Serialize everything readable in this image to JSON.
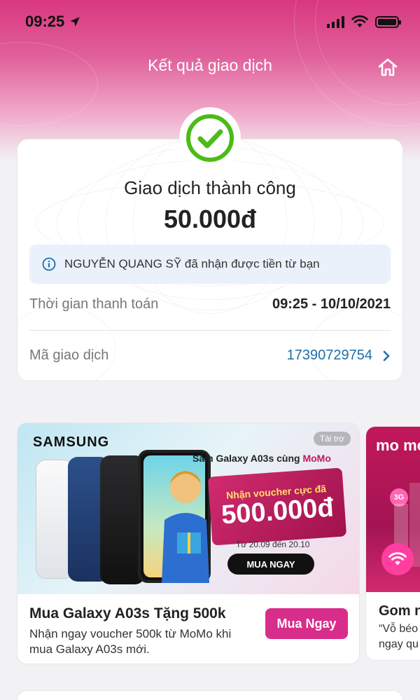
{
  "status_bar": {
    "time": "09:25"
  },
  "header": {
    "title": "Kết quả giao dịch",
    "home_icon": "home-icon"
  },
  "result": {
    "status_text": "Giao dịch thành công",
    "amount": "50.000đ",
    "info_message": "NGUYỄN QUANG SỸ đã nhận được tiền từ bạn",
    "payment_time_label": "Thời gian thanh toán",
    "payment_time_value": "09:25 - 10/10/2021",
    "transaction_id_label": "Mã giao dịch",
    "transaction_id_value": "17390729754"
  },
  "promos": [
    {
      "banner": {
        "brand": "SAMSUNG",
        "sponsor_tag": "Tài trợ",
        "headline_prefix": "Sắm Galaxy A03s cùng",
        "headline_brand": "MoMo",
        "voucher_sub": "Nhận voucher cực đã",
        "voucher_amount": "500.000đ",
        "date_range": "Từ 20.09 đến 20.10",
        "cta": "MUA NGAY"
      },
      "title": "Mua Galaxy A03s Tặng 500k",
      "description": "Nhận ngay voucher 500k từ MoMo khi mua Galaxy A03s mới.",
      "button_label": "Mua Ngay"
    },
    {
      "banner": {
        "brand": "mo mo",
        "badge": "3G"
      },
      "title": "Gom n",
      "description_line1": "“Vỗ béo",
      "description_line2": "ngay qu"
    }
  ],
  "colors": {
    "brand_pink": "#d82d8b",
    "success_green": "#4cbb17",
    "link_blue": "#1c6fa8"
  }
}
